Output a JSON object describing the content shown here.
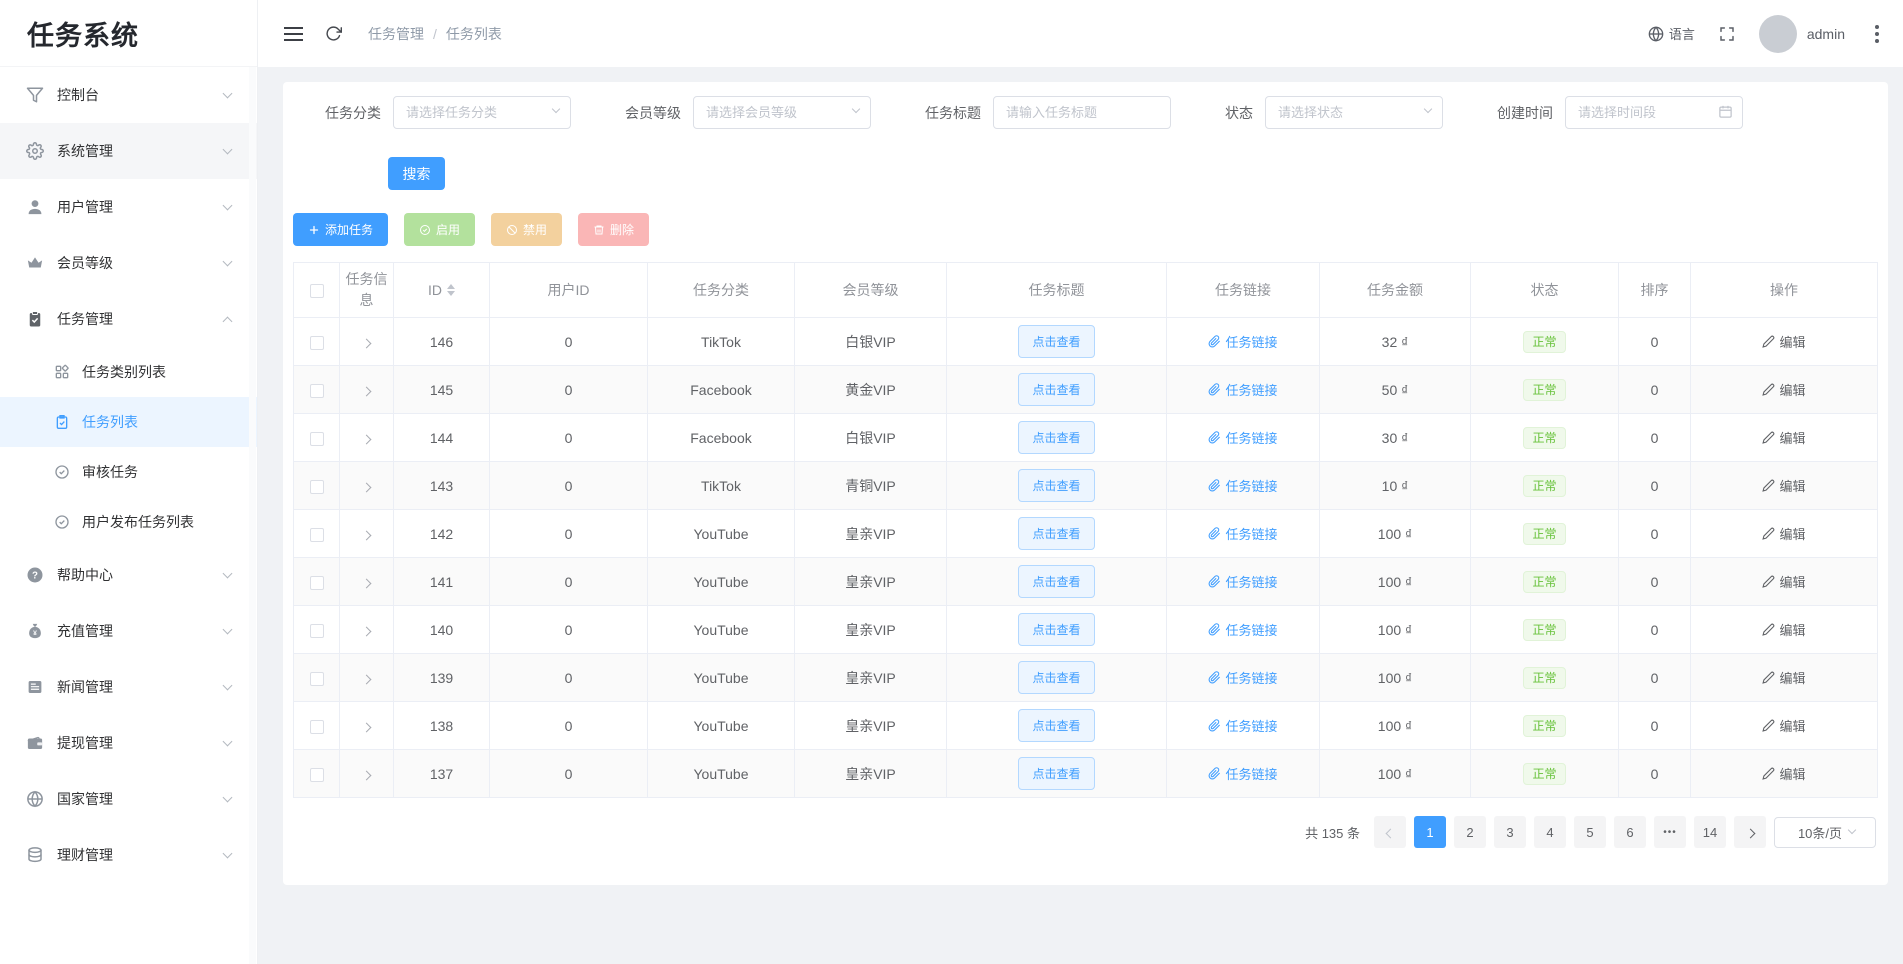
{
  "app": {
    "title": "任务系统"
  },
  "header": {
    "breadcrumb": [
      "任务管理",
      "任务列表"
    ],
    "separator": "/",
    "language_label": "语言",
    "username": "admin"
  },
  "sidebar": {
    "items": [
      {
        "label": "控制台",
        "icon": "console-icon"
      },
      {
        "label": "系统管理",
        "icon": "gear-icon",
        "highlight": true
      },
      {
        "label": "用户管理",
        "icon": "user-icon"
      },
      {
        "label": "会员等级",
        "icon": "crown-icon"
      },
      {
        "label": "任务管理",
        "icon": "task-clipboard-icon",
        "expanded": true,
        "children": [
          {
            "label": "任务类别列表",
            "icon": "grid-icon"
          },
          {
            "label": "任务列表",
            "icon": "task-list-icon",
            "active": true
          },
          {
            "label": "审核任务",
            "icon": "circle-check-icon"
          },
          {
            "label": "用户发布任务列表",
            "icon": "circle-check-icon"
          }
        ]
      },
      {
        "label": "帮助中心",
        "icon": "help-icon"
      },
      {
        "label": "充值管理",
        "icon": "moneybag-icon"
      },
      {
        "label": "新闻管理",
        "icon": "news-icon"
      },
      {
        "label": "提现管理",
        "icon": "wallet-icon"
      },
      {
        "label": "国家管理",
        "icon": "globe-icon"
      },
      {
        "label": "理财管理",
        "icon": "finance-icon"
      }
    ]
  },
  "filters": {
    "category": {
      "label": "任务分类",
      "placeholder": "请选择任务分类"
    },
    "vip": {
      "label": "会员等级",
      "placeholder": "请选择会员等级"
    },
    "title": {
      "label": "任务标题",
      "placeholder": "请输入任务标题"
    },
    "status": {
      "label": "状态",
      "placeholder": "请选择状态"
    },
    "created": {
      "label": "创建时间",
      "placeholder": "请选择时间段"
    },
    "search_label": "搜索"
  },
  "toolbar": {
    "add_label": "添加任务",
    "enable_label": "启用",
    "disable_label": "禁用",
    "delete_label": "删除"
  },
  "table": {
    "columns": [
      "任务信息",
      "ID",
      "用户ID",
      "任务分类",
      "会员等级",
      "任务标题",
      "任务链接",
      "任务金额",
      "状态",
      "排序",
      "操作"
    ],
    "view_button_label": "点击查看",
    "link_label": "任务链接",
    "edit_label": "编辑",
    "rows": [
      {
        "id": "146",
        "user_id": "0",
        "category": "TikTok",
        "vip": "白银VIP",
        "amount": "32 ₫",
        "status": "正常",
        "sort": "0"
      },
      {
        "id": "145",
        "user_id": "0",
        "category": "Facebook",
        "vip": "黄金VIP",
        "amount": "50 ₫",
        "status": "正常",
        "sort": "0"
      },
      {
        "id": "144",
        "user_id": "0",
        "category": "Facebook",
        "vip": "白银VIP",
        "amount": "30 ₫",
        "status": "正常",
        "sort": "0"
      },
      {
        "id": "143",
        "user_id": "0",
        "category": "TikTok",
        "vip": "青铜VIP",
        "amount": "10 ₫",
        "status": "正常",
        "sort": "0"
      },
      {
        "id": "142",
        "user_id": "0",
        "category": "YouTube",
        "vip": "皇亲VIP",
        "amount": "100 ₫",
        "status": "正常",
        "sort": "0"
      },
      {
        "id": "141",
        "user_id": "0",
        "category": "YouTube",
        "vip": "皇亲VIP",
        "amount": "100 ₫",
        "status": "正常",
        "sort": "0"
      },
      {
        "id": "140",
        "user_id": "0",
        "category": "YouTube",
        "vip": "皇亲VIP",
        "amount": "100 ₫",
        "status": "正常",
        "sort": "0"
      },
      {
        "id": "139",
        "user_id": "0",
        "category": "YouTube",
        "vip": "皇亲VIP",
        "amount": "100 ₫",
        "status": "正常",
        "sort": "0"
      },
      {
        "id": "138",
        "user_id": "0",
        "category": "YouTube",
        "vip": "皇亲VIP",
        "amount": "100 ₫",
        "status": "正常",
        "sort": "0"
      },
      {
        "id": "137",
        "user_id": "0",
        "category": "YouTube",
        "vip": "皇亲VIP",
        "amount": "100 ₫",
        "status": "正常",
        "sort": "0"
      }
    ]
  },
  "pagination": {
    "total_label": "共 135 条",
    "pages": [
      "1",
      "2",
      "3",
      "4",
      "5",
      "6",
      "...",
      "14"
    ],
    "active_page": "1",
    "page_size": "10条/页"
  },
  "colors": {
    "primary": "#409eff",
    "success": "#67c23a",
    "success_disabled": "#b3e19d",
    "warning_disabled": "#f3d19e",
    "danger_disabled": "#fab6b6",
    "active_bg": "#ecf5ff"
  }
}
